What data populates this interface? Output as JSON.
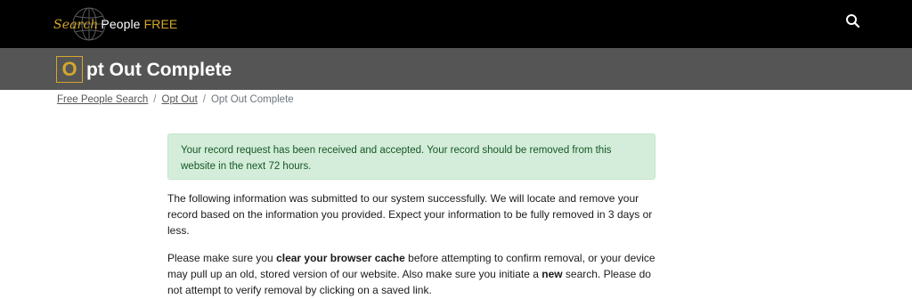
{
  "header": {
    "logo": {
      "search": "Search",
      "people": "People",
      "free": "FREE"
    },
    "search_icon": "search-icon"
  },
  "title": {
    "initial": "O",
    "rest": "pt Out Complete"
  },
  "breadcrumb": {
    "items": [
      "Free People Search",
      "Opt Out"
    ],
    "current": "Opt Out Complete",
    "separator": "/"
  },
  "alert": {
    "text": "Your record request has been received and accepted. Your record should be removed from this website in the next 72 hours."
  },
  "content": {
    "p1": "The following information was submitted to our system successfully. We will locate and remove your record based on the information you provided. Expect your information to be fully removed in 3 days or less.",
    "p2_a": "Please make sure you ",
    "p2_b": "clear your browser cache",
    "p2_c": " before attempting to confirm removal, or your device may pull up an old, stored version of our website. Also make sure you initiate a ",
    "p2_d": "new",
    "p2_e": " search. Please do not attempt to verify removal by clicking on a saved link."
  },
  "colors": {
    "topbar": "#000000",
    "titlebar": "#555555",
    "accent_gold": "#d4a72c",
    "alert_bg": "#d4edda",
    "alert_text": "#155724"
  }
}
